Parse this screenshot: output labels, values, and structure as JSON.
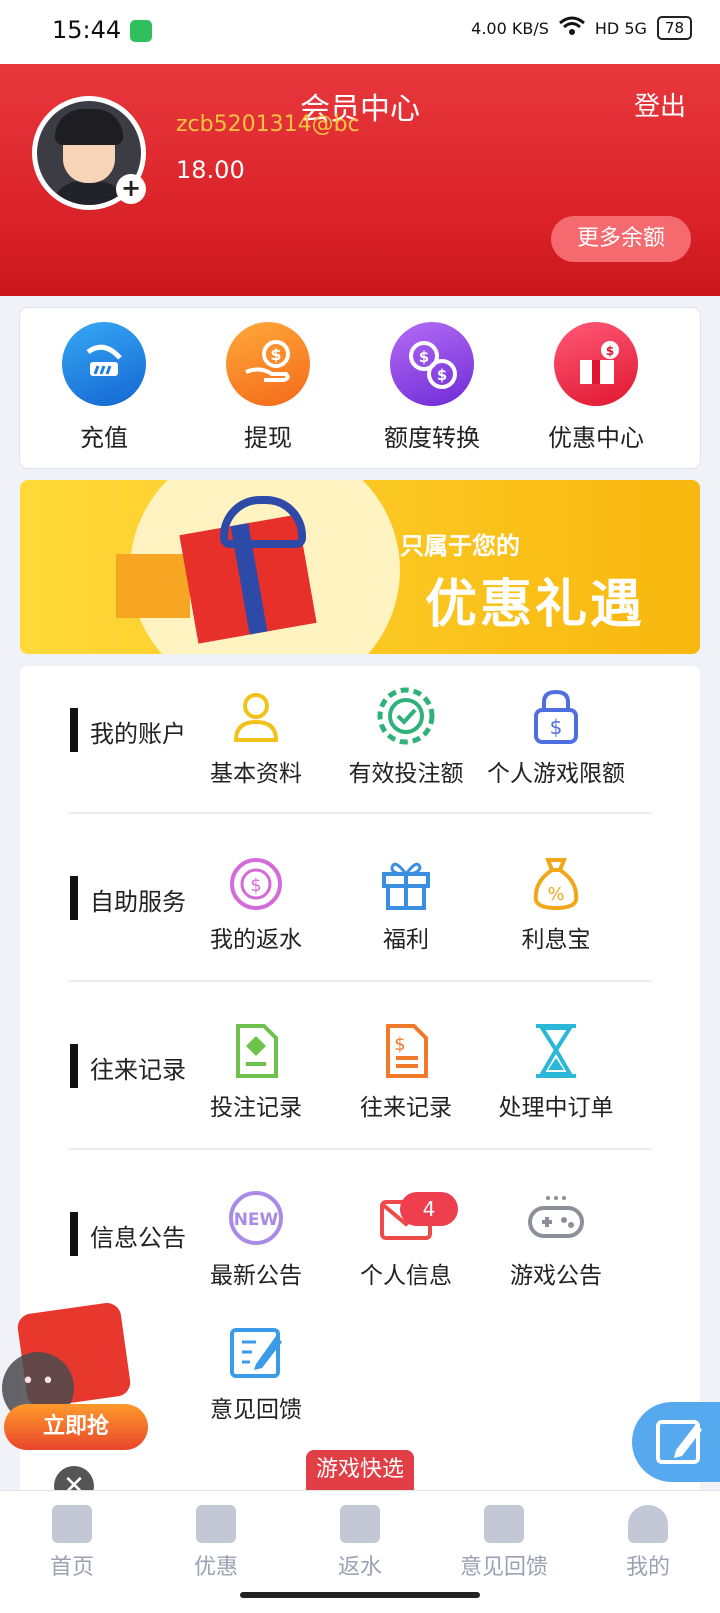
{
  "status_bar": {
    "time": "15:44",
    "speed": "4.00 KB/S",
    "network": "HD 5G",
    "battery": "78"
  },
  "header": {
    "title": "会员中心",
    "logout": "登出"
  },
  "profile": {
    "username": "zcb5201314@bc",
    "balance": "18.00",
    "more_balance": "更多余额"
  },
  "quick_actions": [
    {
      "label": "充值",
      "icon": "deposit-icon",
      "color": "#1f7fe0"
    },
    {
      "label": "提现",
      "icon": "withdraw-icon",
      "color": "#f47a16"
    },
    {
      "label": "额度转换",
      "icon": "transfer-icon",
      "color": "#8a3fe0"
    },
    {
      "label": "优惠中心",
      "icon": "promo-center-icon",
      "color": "#ec2d4a"
    }
  ],
  "banner": {
    "subtitle": "只属于您的",
    "title": "优惠礼遇"
  },
  "sections": [
    {
      "title": "我的账户",
      "items": [
        {
          "label": "基本资料",
          "icon": "user-icon",
          "color": "#f2c21a"
        },
        {
          "label": "有效投注额",
          "icon": "chip-check-icon",
          "color": "#2fb27a"
        },
        {
          "label": "个人游戏限额",
          "icon": "lock-dollar-icon",
          "color": "#4f6fe0"
        }
      ]
    },
    {
      "title": "自助服务",
      "items": [
        {
          "label": "我的返水",
          "icon": "rebate-icon",
          "color": "#d56bd9"
        },
        {
          "label": "福利",
          "icon": "gift-icon",
          "color": "#3b8fe0"
        },
        {
          "label": "利息宝",
          "icon": "money-bag-icon",
          "color": "#f0a81a"
        }
      ]
    },
    {
      "title": "往来记录",
      "items": [
        {
          "label": "投注记录",
          "icon": "bet-record-icon",
          "color": "#6cc24a"
        },
        {
          "label": "往来记录",
          "icon": "transaction-record-icon",
          "color": "#f07a2a"
        },
        {
          "label": "处理中订单",
          "icon": "hourglass-icon",
          "color": "#2bb7d8"
        }
      ]
    },
    {
      "title": "信息公告",
      "items": [
        {
          "label": "最新公告",
          "icon": "new-icon",
          "color": "#a98be6"
        },
        {
          "label": "个人信息",
          "icon": "mail-icon",
          "color": "#ef4a4a",
          "badge": "4"
        },
        {
          "label": "游戏公告",
          "icon": "gamepad-icon",
          "color": "#8b8f98"
        },
        {
          "label": "意见回馈",
          "icon": "feedback-icon",
          "color": "#3a9be8"
        }
      ]
    }
  ],
  "promo_float": {
    "button": "立即抢",
    "close": "✕"
  },
  "quick_game": "游戏快选",
  "bottom_nav": [
    {
      "label": "首页",
      "icon": "home-icon"
    },
    {
      "label": "优惠",
      "icon": "gift-nav-icon"
    },
    {
      "label": "返水",
      "icon": "rebate-nav-icon"
    },
    {
      "label": "意见回馈",
      "icon": "feedback-nav-icon"
    },
    {
      "label": "我的",
      "icon": "profile-nav-icon"
    }
  ]
}
